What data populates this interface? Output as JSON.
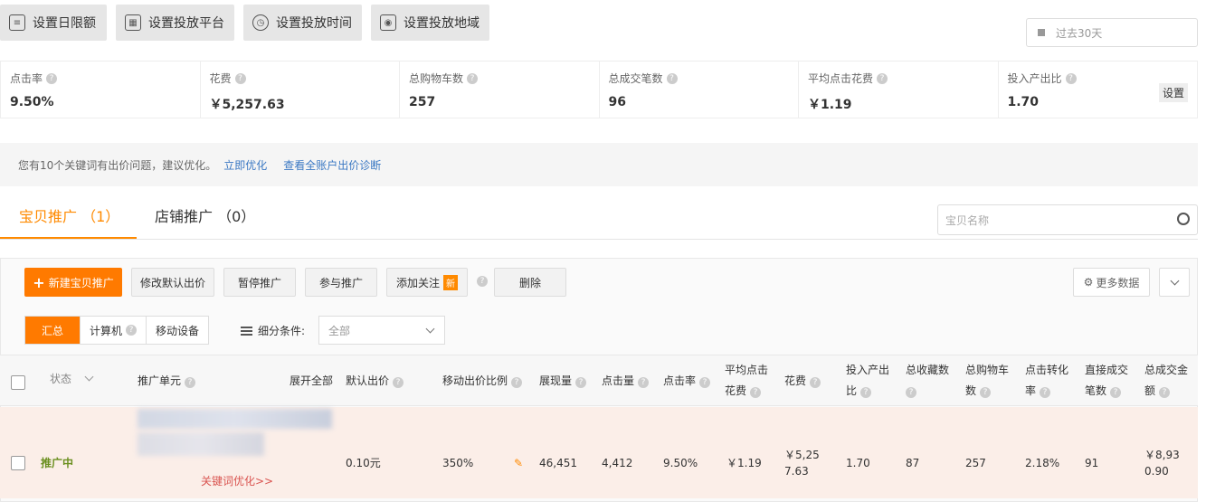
{
  "top_buttons": [
    {
      "label": "设置日限额",
      "icon": "sliders-icon"
    },
    {
      "label": "设置投放平台",
      "icon": "platform-icon"
    },
    {
      "label": "设置投放时间",
      "icon": "clock-icon"
    },
    {
      "label": "设置投放地域",
      "icon": "location-icon"
    }
  ],
  "date_range": "过去30天",
  "metrics": [
    {
      "label": "点击率",
      "value": "9.50%"
    },
    {
      "label": "花费",
      "value": "￥5,257.63"
    },
    {
      "label": "总购物车数",
      "value": "257"
    },
    {
      "label": "总成交笔数",
      "value": "96"
    },
    {
      "label": "平均点击花费",
      "value": "￥1.19"
    },
    {
      "label": "投入产出比",
      "value": "1.70"
    }
  ],
  "metrics_setting_label": "设置",
  "notice": {
    "text": "您有10个关键词有出价问题，建议优化。",
    "link1": "立即优化",
    "link2": "查看全账户出价诊断"
  },
  "tabs": {
    "tab1": "宝贝推广 （1）",
    "tab2": "店铺推广 （0）"
  },
  "search_placeholder": "宝贝名称",
  "toolbar": {
    "new_label": "新建宝贝推广",
    "modify_bid": "修改默认出价",
    "pause": "暂停推广",
    "join": "参与推广",
    "follow": "添加关注",
    "new_badge": "新",
    "delete": "删除",
    "more_data": "更多数据"
  },
  "segments": {
    "summary": "汇总",
    "computer": "计算机",
    "mobile": "移动设备"
  },
  "filter_label": "细分条件:",
  "filter_value": "全部",
  "headers": {
    "status": "状态",
    "unit": "推广单元",
    "expand": "展开全部",
    "default_bid": "默认出价",
    "mobile_ratio": "移动出价比例",
    "impressions": "展现量",
    "clicks": "点击量",
    "ctr": "点击率",
    "avg_cpc_1": "平均点击",
    "avg_cpc_2": "花费",
    "cost": "花费",
    "roi_1": "投入产出",
    "roi_2": "比",
    "favs": "总收藏数",
    "carts_1": "总购物车",
    "carts_2": "数",
    "conv_1": "点击转化",
    "conv_2": "率",
    "direct_1": "直接成交",
    "direct_2": "笔数",
    "total_1": "总成交金",
    "total_2": "额"
  },
  "row": {
    "status": "推广中",
    "keyword_link": "关键词优化>>",
    "default_bid": "0.10元",
    "mobile_ratio": "350%",
    "impressions": "46,451",
    "clicks": "4,412",
    "ctr": "9.50%",
    "avg_cpc": "￥1.19",
    "cost_1": "￥5,25",
    "cost_2": "7.63",
    "roi": "1.70",
    "favs": "87",
    "carts": "257",
    "conv": "2.18%",
    "direct": "91",
    "total_1": "￥8,93",
    "total_2": "0.90"
  }
}
